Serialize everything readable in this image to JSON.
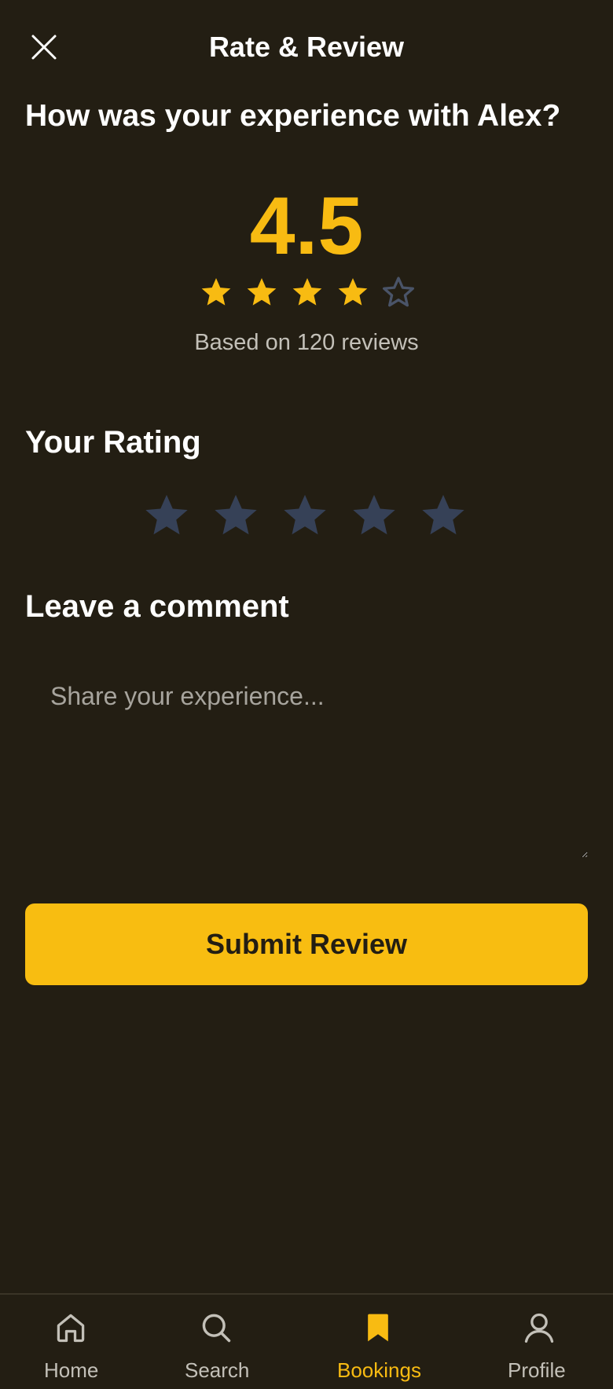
{
  "header": {
    "title": "Rate & Review",
    "close_icon": "close-icon"
  },
  "question": "How was your experience with Alex?",
  "summary": {
    "score": "4.5",
    "stars_filled": 4,
    "stars_total": 5,
    "review_count_text": "Based on 120 reviews"
  },
  "rating": {
    "title": "Your Rating",
    "selected": 0,
    "max": 5
  },
  "comment": {
    "title": "Leave a comment",
    "value": "",
    "placeholder": "Share your experience..."
  },
  "submit_label": "Submit Review",
  "nav": {
    "items": [
      {
        "label": "Home",
        "icon": "home-icon",
        "active": false
      },
      {
        "label": "Search",
        "icon": "search-icon",
        "active": false
      },
      {
        "label": "Bookings",
        "icon": "bookmark-icon",
        "active": true
      },
      {
        "label": "Profile",
        "icon": "user-icon",
        "active": false
      }
    ]
  },
  "colors": {
    "background": "#231e13",
    "accent": "#f8bb12",
    "star_empty": "#364157",
    "text_secondary": "#c3c0b8"
  }
}
